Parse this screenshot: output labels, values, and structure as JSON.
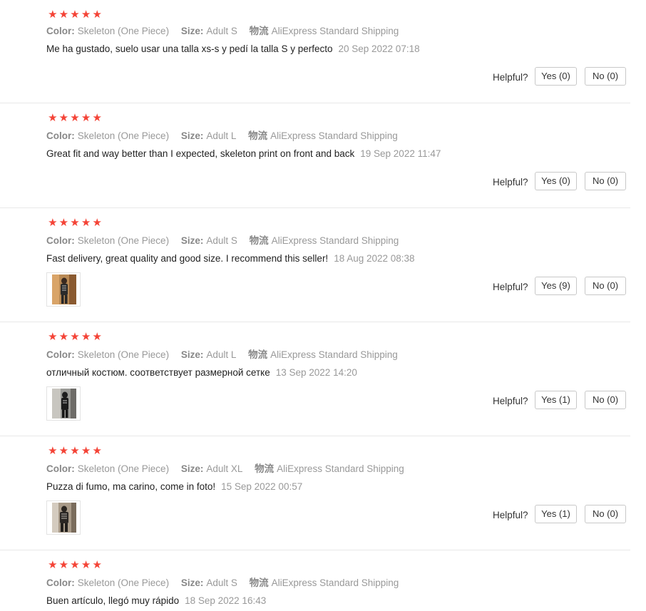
{
  "labels": {
    "color": "Color:",
    "size": "Size:",
    "shipping": "物流",
    "helpful": "Helpful?"
  },
  "colors": {
    "star": "#f44336",
    "meta_text": "#999999",
    "body_text": "#222222",
    "divider": "#e8e8e8"
  },
  "reviews": [
    {
      "rating": 5,
      "color": "Skeleton (One Piece)",
      "size": "Adult S",
      "shipping": "AliExpress Standard Shipping",
      "text": "Me ha gustado, suelo usar una talla xs-s y pedí la talla S y perfecto",
      "date": "20 Sep 2022 07:18",
      "has_photo": false,
      "yes_label": "Yes (0)",
      "no_label": "No (0)"
    },
    {
      "rating": 5,
      "color": "Skeleton (One Piece)",
      "size": "Adult L",
      "shipping": "AliExpress Standard Shipping",
      "text": "Great fit and way better than I expected, skeleton print on front and back",
      "date": "19 Sep 2022 11:47",
      "has_photo": false,
      "yes_label": "Yes (0)",
      "no_label": "No (0)"
    },
    {
      "rating": 5,
      "color": "Skeleton (One Piece)",
      "size": "Adult S",
      "shipping": "AliExpress Standard Shipping",
      "text": "Fast delivery, great quality and good size. I recommend this seller!",
      "date": "18 Aug 2022 08:38",
      "has_photo": true,
      "yes_label": "Yes (9)",
      "no_label": "No (0)"
    },
    {
      "rating": 5,
      "color": "Skeleton (One Piece)",
      "size": "Adult L",
      "shipping": "AliExpress Standard Shipping",
      "text": "отличный костюм. соответствует размерной сетке",
      "date": "13 Sep 2022 14:20",
      "has_photo": true,
      "yes_label": "Yes (1)",
      "no_label": "No (0)"
    },
    {
      "rating": 5,
      "color": "Skeleton (One Piece)",
      "size": "Adult XL",
      "shipping": "AliExpress Standard Shipping",
      "text": "Puzza di fumo, ma carino, come in foto!",
      "date": "15 Sep 2022 00:57",
      "has_photo": true,
      "yes_label": "Yes (1)",
      "no_label": "No (0)"
    },
    {
      "rating": 5,
      "color": "Skeleton (One Piece)",
      "size": "Adult S",
      "shipping": "AliExpress Standard Shipping",
      "text": "Buen artículo, llegó muy rápido",
      "date": "18 Sep 2022 16:43",
      "has_photo": false,
      "yes_label": "",
      "no_label": ""
    }
  ]
}
